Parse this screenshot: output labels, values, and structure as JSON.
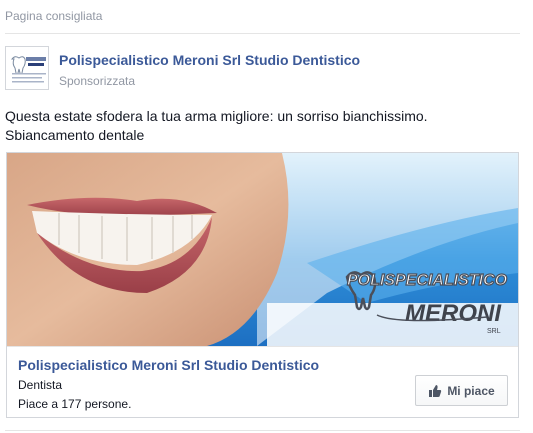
{
  "section": {
    "title": "Pagina consigliata"
  },
  "page": {
    "name": "Polispecialistico Meroni Srl Studio Dentistico",
    "sponsored_label": "Sponsorizzata"
  },
  "ad": {
    "text_line1": "Questa estate sfodera la tua arma migliore: un sorriso bianchissimo.",
    "text_line2": "Sbiancamento dentale"
  },
  "image": {
    "logo_top": "POLISPECIALISTICO",
    "logo_main": "MERONI",
    "logo_sub": "SRL"
  },
  "card": {
    "title": "Polispecialistico Meroni Srl Studio Dentistico",
    "category": "Dentista",
    "likes": "Piace a 177 persone.",
    "like_button": "Mi piace"
  },
  "colors": {
    "link_blue": "#3b5998",
    "meta_gray": "#9197a3",
    "sky_blue": "#2f8fd9"
  }
}
